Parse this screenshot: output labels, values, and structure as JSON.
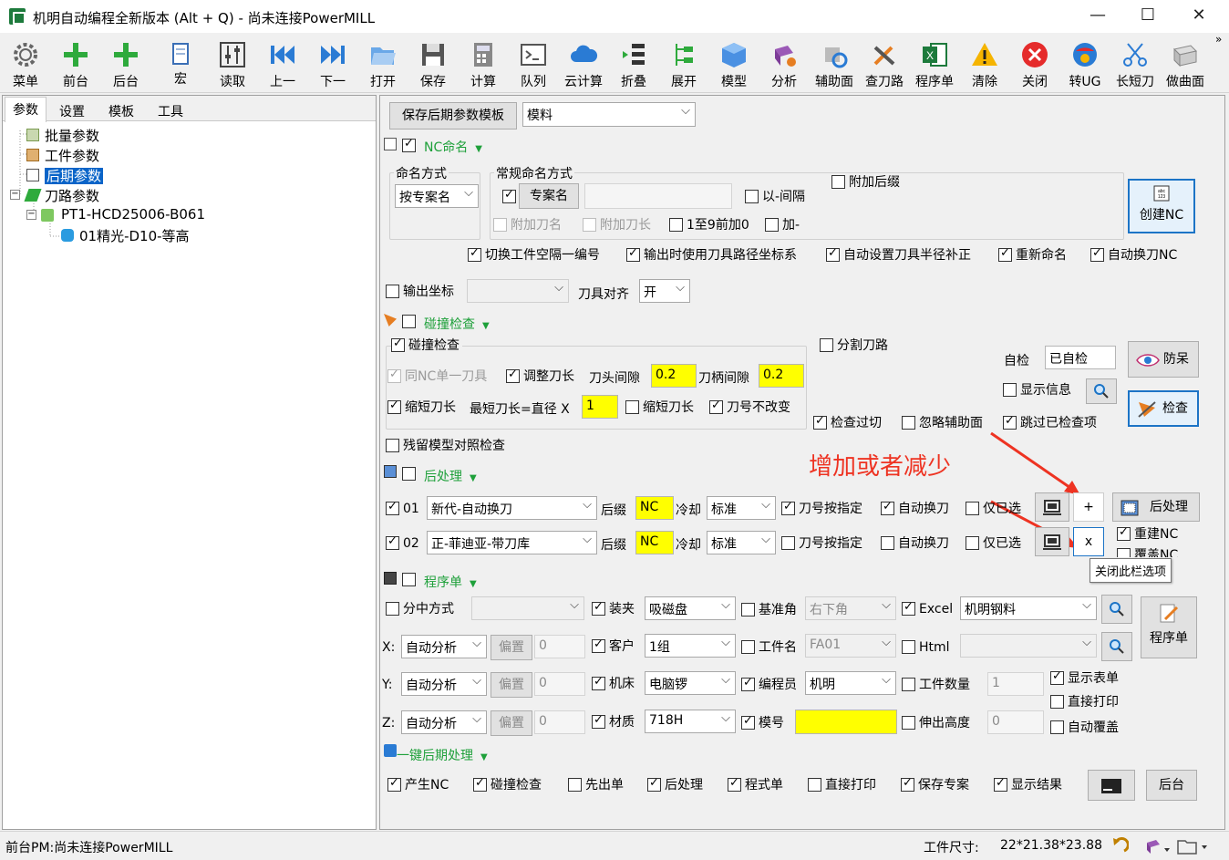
{
  "window": {
    "title": "机明自动编程全新版本 (Alt + Q) - 尚未连接PowerMILL",
    "minimize": "—",
    "maximize": "☐",
    "close": "✕"
  },
  "toolbar": {
    "items": [
      {
        "label": "菜单"
      },
      {
        "label": "前台"
      },
      {
        "label": "后台"
      },
      {
        "label": "宏"
      },
      {
        "label": "读取"
      },
      {
        "label": "上一"
      },
      {
        "label": "下一"
      },
      {
        "label": "打开"
      },
      {
        "label": "保存"
      },
      {
        "label": "计算"
      },
      {
        "label": "队列"
      },
      {
        "label": "云计算"
      },
      {
        "label": "折叠"
      },
      {
        "label": "展开"
      },
      {
        "label": "模型"
      },
      {
        "label": "分析"
      },
      {
        "label": "辅助面"
      },
      {
        "label": "查刀路"
      },
      {
        "label": "程序单"
      },
      {
        "label": "清除"
      },
      {
        "label": "关闭"
      },
      {
        "label": "转UG"
      },
      {
        "label": "长短刀"
      },
      {
        "label": "做曲面"
      }
    ],
    "overflow": "»"
  },
  "left": {
    "tabs": [
      "参数",
      "设置",
      "模板",
      "工具"
    ],
    "tree": [
      "批量参数",
      "工件参数",
      "后期参数",
      "刀路参数",
      "PT1-HCD25006-B061",
      "01精光-D10-等高"
    ]
  },
  "panel": {
    "save_template": "保存后期参数模板",
    "template_value": "模料",
    "nc": {
      "title": "NC命名",
      "naming_mode_label": "命名方式",
      "naming_mode_value": "按专案名",
      "regular_label": "常规命名方式",
      "project_name_btn": "专案名",
      "dash_sep": "以-间隔",
      "add_suffix": "附加后缀",
      "add_tool_name": "附加刀名",
      "add_tool_length": "附加刀长",
      "zero_pad": "1至9前加0",
      "plus": "加-",
      "create_nc": "创建NC",
      "opt1": "切换工件空隔一编号",
      "opt2": "输出时使用刀具路径坐标系",
      "opt3": "自动设置刀具半径补正",
      "opt4": "重新命名",
      "opt5": "自动换刀NC"
    },
    "output_coord": "输出坐标",
    "tool_align_label": "刀具对齐",
    "tool_align_value": "开",
    "collision": {
      "title": "碰撞检查",
      "group_label": "碰撞检查",
      "same_nc_tool": "同NC单一刀具",
      "adjust_length": "调整刀长",
      "head_gap_label": "刀头间隙",
      "head_gap": "0.2",
      "holder_gap_label": "刀柄间隙",
      "holder_gap": "0.2",
      "shorten": "缩短刀长",
      "min_len_label": "最短刀长=直径 X",
      "min_len": "1",
      "shorten2": "缩短刀长",
      "keep_num": "刀号不改变",
      "split_path": "分割刀路",
      "self_check_label": "自检",
      "self_check_value": "已自检",
      "anti_dumb": "防呆",
      "show_info": "显示信息",
      "check": "检查",
      "check_overcut": "检查过切",
      "ignore_aux": "忽略辅助面",
      "skip_checked": "跳过已检查项"
    },
    "residual": "残留模型对照检查",
    "annotation": "增加或者减少",
    "post": {
      "title": "后处理",
      "rows": [
        {
          "num": "01",
          "processor": "新代-自动换刀",
          "suffix_label": "后缀",
          "suffix": "NC",
          "cool_label": "冷却",
          "cool": "标准",
          "tool_spec": "刀号按指定",
          "auto_change": "自动换刀",
          "only_sel": "仅已选"
        },
        {
          "num": "02",
          "processor": "正-菲迪亚-带刀库",
          "suffix_label": "后缀",
          "suffix": "NC",
          "cool_label": "冷却",
          "cool": "标准",
          "tool_spec": "刀号按指定",
          "auto_change": "自动换刀",
          "only_sel": "仅已选"
        }
      ],
      "add_btn": "+",
      "remove_btn": "x",
      "post_btn": "后处理",
      "rebuild_nc": "重建NC",
      "overwrite_nc": "覆盖NC",
      "tooltip": "关闭此栏选项"
    },
    "prog": {
      "title": "程序单",
      "split_mode": "分中方式",
      "clamp": "装夹",
      "clamp_value": "吸磁盘",
      "datum": "基准角",
      "datum_value": "右下角",
      "excel": "Excel",
      "excel_value": "机明钢料",
      "prog_btn": "程序单",
      "x_label": "X:",
      "y_label": "Y:",
      "z_label": "Z:",
      "axis_mode": "自动分析",
      "offset_btn": "偏置",
      "offset_value": "0",
      "customer": "客户",
      "customer_value": "1组",
      "part_name": "工件名",
      "part_name_value": "FA01",
      "html": "Html",
      "machine": "机床",
      "machine_value": "电脑锣",
      "programmer": "编程员",
      "programmer_value": "机明",
      "part_count": "工件数量",
      "part_count_value": "1",
      "show_sheet": "显示表单",
      "direct_print": "直接打印",
      "auto_overwrite": "自动覆盖",
      "material": "材质",
      "material_value": "718H",
      "mold_no": "模号",
      "extend_height": "伸出高度",
      "extend_value": "0"
    },
    "onekey": {
      "title": "一键后期处理",
      "gen_nc": "产生NC",
      "collision": "碰撞检查",
      "first_sheet": "先出单",
      "post": "后处理",
      "prog": "程式单",
      "print": "直接打印",
      "save_project": "保存专案",
      "show_result": "显示结果",
      "backend": "后台"
    }
  },
  "status": {
    "left": "前台PM:尚未连接PowerMILL",
    "size_label": "工件尺寸:",
    "size_value": "22*21.38*23.88"
  }
}
